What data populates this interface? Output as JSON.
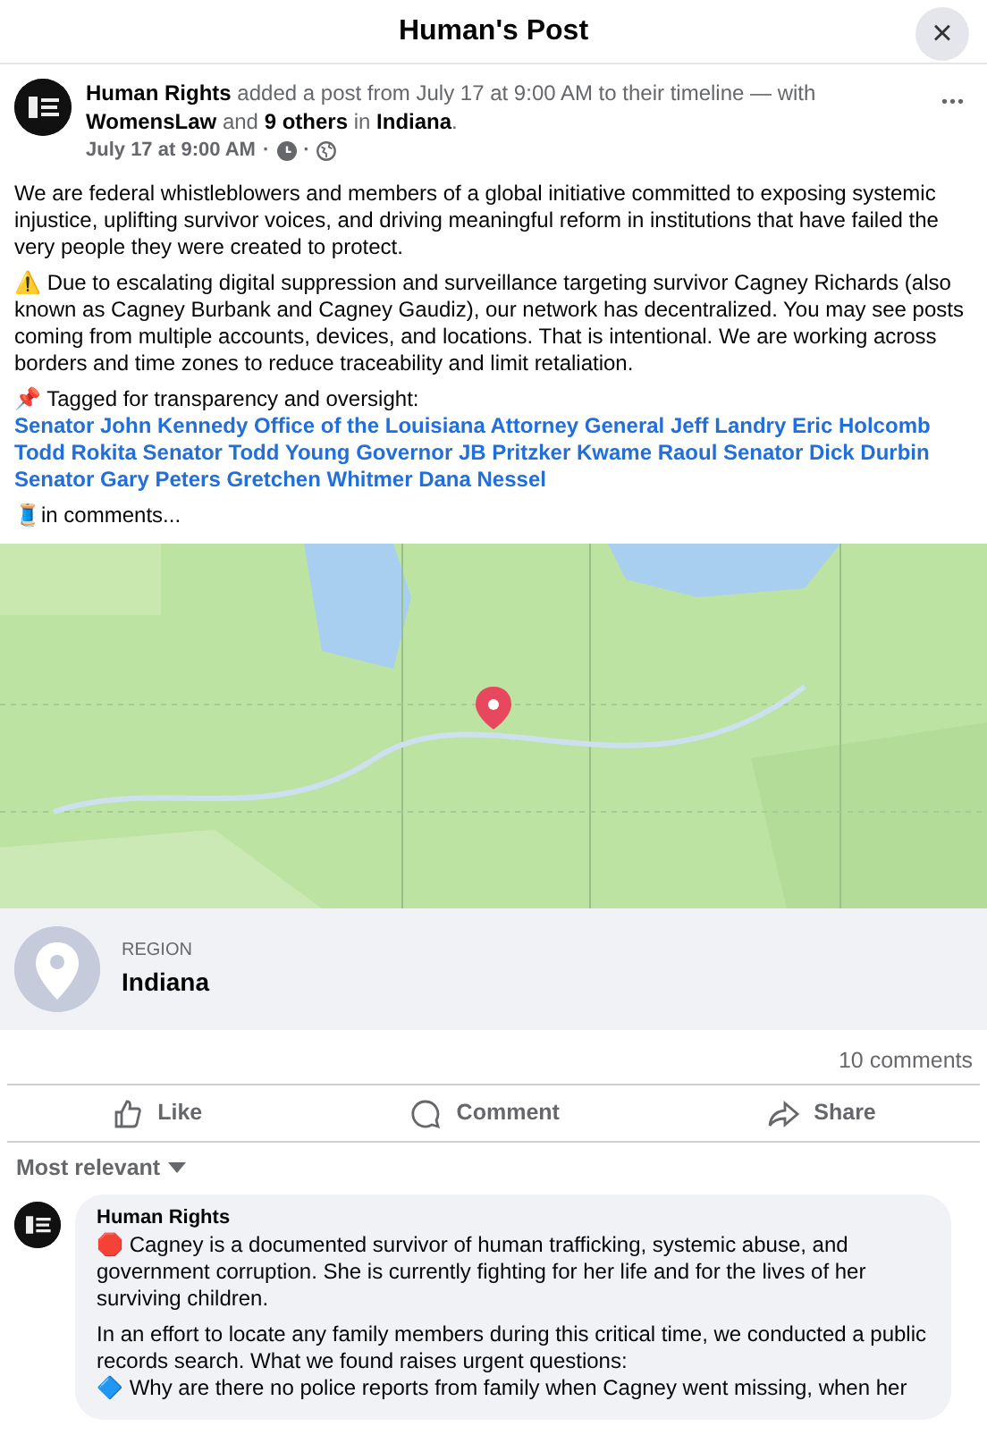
{
  "dialog": {
    "title": "Human's Post",
    "close": "×"
  },
  "post": {
    "header": "**Human Rights** added a post from July 17 at 9:00 AM to their timeline — with **WomensLaw** and **9 others** in **Indiana**.",
    "time": "July 17 at 9:00 AM",
    "separator": "·",
    "more": "•••",
    "paragraphs": [
      {
        "kind": "text",
        "text": "We are federal whistleblowers and members of a global initiative committed to exposing systemic injustice, uplifting survivor voices, and driving meaningful reform in institutions that have failed the very people they were created to protect."
      },
      {
        "kind": "text",
        "text": "⚠️ Due to escalating digital suppression and surveillance targeting survivor Cagney Richards (also known as Cagney Burbank and Cagney Gaudiz), our network has decentralized. You may see posts coming from multiple accounts, devices, and locations. That is intentional. We are working across borders and time zones to reduce traceability and limit retaliation."
      },
      {
        "kind": "tags",
        "text": "📌 Tagged for transparency and oversight:",
        "links": "Senator John Kennedy Office of the Louisiana Attorney General Jeff Landry Eric Holcomb Todd Rokita Senator Todd Young Governor JB Pritzker Kwame Raoul Senator Dick Durbin Senator Gary Peters Gretchen Whitmer Dana Nessel"
      },
      {
        "kind": "text",
        "text": "🧵in comments..."
      }
    ],
    "location": {
      "label": "REGION",
      "name": "Indiana"
    },
    "comments_count": "10 comments",
    "actions": [
      {
        "kind": "like",
        "label": "Like"
      },
      {
        "kind": "comment",
        "label": "Comment"
      },
      {
        "kind": "share",
        "label": "Share"
      }
    ]
  },
  "sort": {
    "label": "Most relevant"
  },
  "comments": [
    {
      "author": "Human Rights",
      "paragraphs": [
        {
          "lines": [
            "🛑 Cagney is a documented survivor of human trafficking, systemic abuse, and government corruption. She is currently fighting for her life and for the lives of her surviving children."
          ]
        },
        {
          "lines": [
            "In an effort to locate any family members during this critical time, we conducted a public records search. What we found raises urgent questions:",
            "🔷 Why are there no police reports from family when Cagney went missing, when her"
          ]
        }
      ]
    }
  ]
}
